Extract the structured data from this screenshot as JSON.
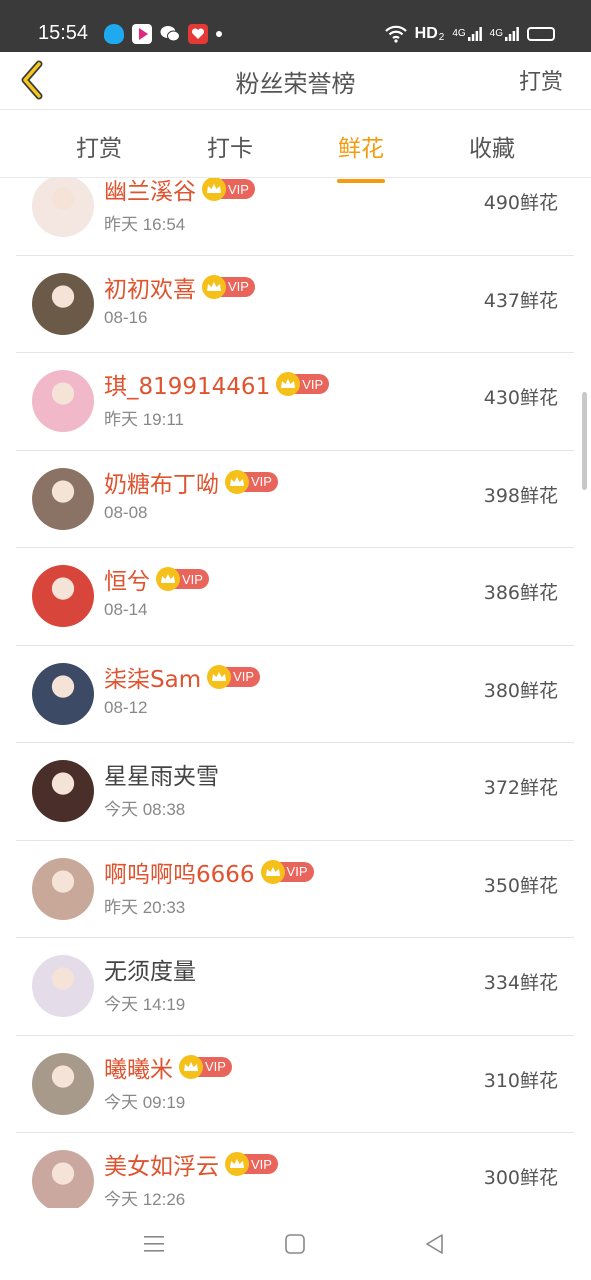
{
  "status_bar": {
    "time": "15:54",
    "network_label": "HD",
    "network_sub": "2",
    "signal1": "4G",
    "signal2": "4G",
    "icons": [
      "qq-icon",
      "video-app-icon",
      "wechat-icon",
      "red-app-icon"
    ]
  },
  "header": {
    "title": "粉丝荣誉榜",
    "action_label": "打赏"
  },
  "tabs": [
    {
      "label": "打赏",
      "active": false
    },
    {
      "label": "打卡",
      "active": false
    },
    {
      "label": "鲜花",
      "active": true
    },
    {
      "label": "收藏",
      "active": false
    }
  ],
  "vip_label": "VIP",
  "fans": [
    {
      "name": "幽兰溪谷",
      "vip": true,
      "time": "昨天 16:54",
      "amount": "490鲜花",
      "avatar_color": "#f4e6e0"
    },
    {
      "name": "初初欢喜",
      "vip": true,
      "time": "08-16",
      "amount": "437鲜花",
      "avatar_color": "#6b5a48"
    },
    {
      "name": "琪_819914461",
      "vip": true,
      "time": "昨天 19:11",
      "amount": "430鲜花",
      "avatar_color": "#f0b8c8"
    },
    {
      "name": "奶糖布丁呦",
      "vip": true,
      "time": "08-08",
      "amount": "398鲜花",
      "avatar_color": "#8a7265"
    },
    {
      "name": "恒兮",
      "vip": true,
      "time": "08-14",
      "amount": "386鲜花",
      "avatar_color": "#d8453a"
    },
    {
      "name": "柒柒Sam",
      "vip": true,
      "time": "08-12",
      "amount": "380鲜花",
      "avatar_color": "#3d4a66"
    },
    {
      "name": "星星雨夹雪",
      "vip": false,
      "time": "今天 08:38",
      "amount": "372鲜花",
      "avatar_color": "#4a2e2a"
    },
    {
      "name": "啊呜啊呜6666",
      "vip": true,
      "time": "昨天 20:33",
      "amount": "350鲜花",
      "avatar_color": "#c8a898"
    },
    {
      "name": "无须度量",
      "vip": false,
      "time": "今天 14:19",
      "amount": "334鲜花",
      "avatar_color": "#e4dce8"
    },
    {
      "name": "曦曦米",
      "vip": true,
      "time": "今天 09:19",
      "amount": "310鲜花",
      "avatar_color": "#a89a8a"
    },
    {
      "name": "美女如浮云",
      "vip": true,
      "time": "今天 12:26",
      "amount": "300鲜花",
      "avatar_color": "#caa8a0"
    }
  ],
  "colors": {
    "accent": "#f39c12",
    "vip_name": "#e0532f",
    "vip_badge": "#e9645a",
    "crown": "#f5c01a"
  }
}
